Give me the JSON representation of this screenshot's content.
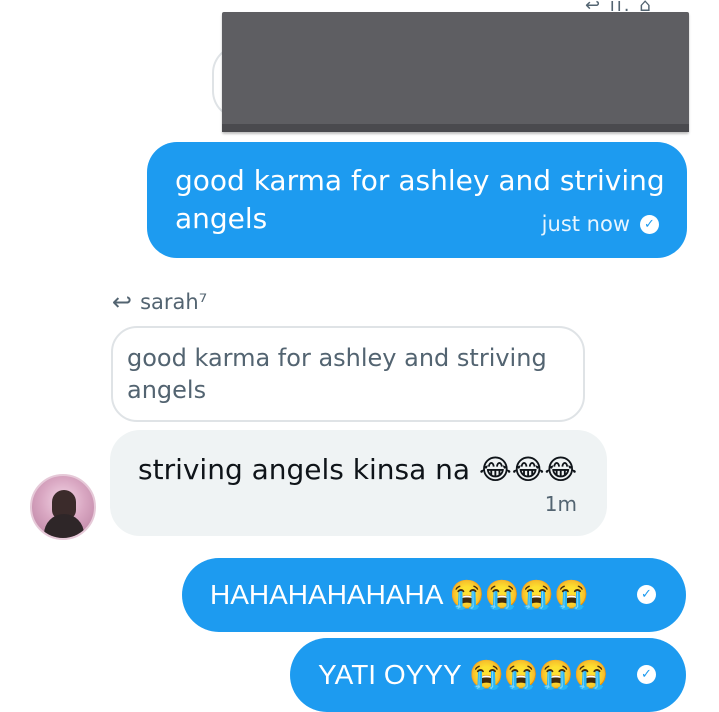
{
  "header": {
    "glyphs": "↩ ıı. ⌂"
  },
  "messages": [
    {
      "id": "sent-1",
      "text": "good karma for ashley and striving angels",
      "time": "just now",
      "status": "✓"
    },
    {
      "id": "received-1",
      "reply_to": {
        "icon": "↩",
        "name": "sarah⁷",
        "quoted_text": "good karma for ashley and striving angels"
      },
      "text": "striving angels kinsa na 😂😂😂",
      "time": "1m"
    },
    {
      "id": "sent-2",
      "text": "HAHAHAHAHAHA 😭😭😭😭",
      "status": "✓"
    },
    {
      "id": "sent-3",
      "text": "YATI OYYY 😭😭😭😭",
      "status": "✓"
    }
  ],
  "colors": {
    "accent": "#1d9bf0",
    "received_bg": "#eff3f4",
    "muted": "#536471",
    "redaction": "#5e5e62"
  }
}
